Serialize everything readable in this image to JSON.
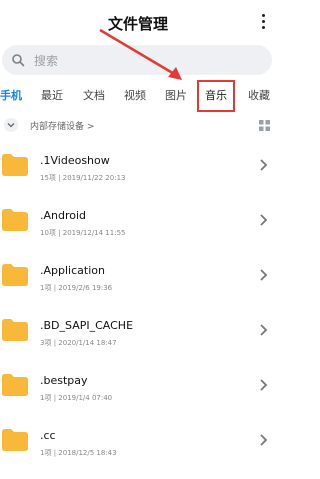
{
  "header": {
    "title": "文件管理"
  },
  "search": {
    "placeholder": "搜索"
  },
  "tabs": [
    {
      "label": "手机",
      "active": true
    },
    {
      "label": "最近"
    },
    {
      "label": "文档"
    },
    {
      "label": "视频"
    },
    {
      "label": "图片"
    },
    {
      "label": "音乐",
      "highlighted": true
    },
    {
      "label": "收藏"
    }
  ],
  "location": {
    "label": "内部存储设备 >"
  },
  "folders": [
    {
      "name": ".1Videoshow",
      "count": "15项",
      "date": "2019/11/22 20:13"
    },
    {
      "name": ".Android",
      "count": "10项",
      "date": "2019/12/14 11:55"
    },
    {
      "name": ".Application",
      "count": "1项",
      "date": "2019/2/6 19:36"
    },
    {
      "name": ".BD_SAPI_CACHE",
      "count": "3项",
      "date": "2020/1/14 18:47"
    },
    {
      "name": ".bestpay",
      "count": "1项",
      "date": "2019/1/4 07:40"
    },
    {
      "name": ".cc",
      "count": "1项",
      "date": "2018/12/5 18:43"
    }
  ],
  "colors": {
    "accent": "#0e86f5",
    "folder": "#f8b93a",
    "highlight": "#e53935"
  }
}
